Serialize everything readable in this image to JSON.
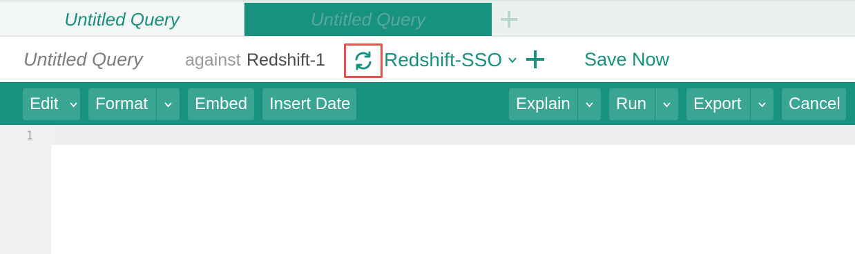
{
  "tabs": [
    {
      "label": "Untitled Query",
      "active": false
    },
    {
      "label": "Untitled Query",
      "active": true
    }
  ],
  "header": {
    "query_title": "Untitled Query",
    "against_label": "against",
    "connection_name": "Redshift-1",
    "refresh_icon": "refresh-icon",
    "database_selected": "Redshift-SSO",
    "save_label": "Save Now"
  },
  "toolbar": {
    "edit_label": "Edit",
    "format_label": "Format",
    "embed_label": "Embed",
    "insert_date_label": "Insert Date",
    "explain_label": "Explain",
    "run_label": "Run",
    "export_label": "Export",
    "cancel_label": "Cancel"
  },
  "editor": {
    "line_numbers": [
      "1"
    ],
    "content": ""
  },
  "colors": {
    "accent": "#17927f",
    "button": "#3aa593",
    "highlight_box": "#e2574c"
  }
}
